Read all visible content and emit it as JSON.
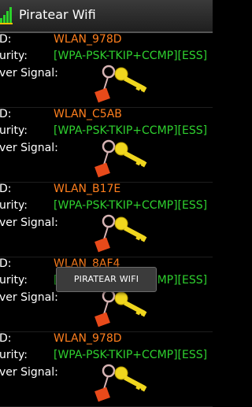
{
  "app": {
    "title": "Piratear Wifi",
    "icon": "wifi-signal-bars-icon"
  },
  "labels": {
    "ssid": "D:",
    "security": "urity:",
    "power": "ver Signal:"
  },
  "networks": [
    {
      "ssid": "WLAN_978D",
      "security": "[WPA-PSK-TKIP+CCMP][ESS]"
    },
    {
      "ssid": "WLAN_C5AB",
      "security": "[WPA-PSK-TKIP+CCMP][ESS]"
    },
    {
      "ssid": "WLAN_B17E",
      "security": "[WPA-PSK-TKIP+CCMP][ESS]"
    },
    {
      "ssid": "WLAN_8AF4",
      "security": "[WPA-PSK-TKIP+CCMP][ESS]"
    },
    {
      "ssid": "WLAN_978D",
      "security": "[WPA-PSK-TKIP+CCMP][ESS]"
    }
  ],
  "toast": {
    "text": "PIRATEAR WIFI"
  },
  "colors": {
    "ssid": "#ff7f1e",
    "security": "#2fd12f",
    "background": "#000000"
  }
}
